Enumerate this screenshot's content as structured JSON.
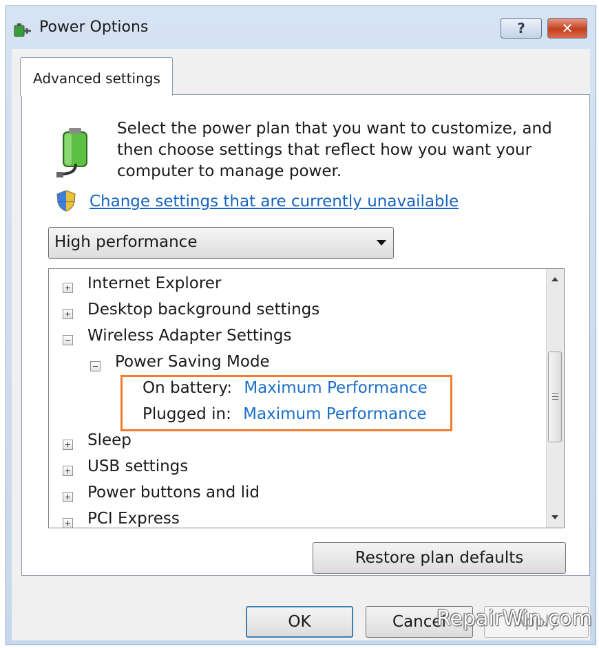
{
  "window": {
    "title": "Power Options",
    "help_label": "?",
    "close_label": "✕"
  },
  "tabs": [
    {
      "label": "Advanced settings"
    }
  ],
  "panel": {
    "description": "Select the power plan that you want to customize, and then choose settings that reflect how you want your computer to manage power.",
    "change_link": "Change settings that are currently unavailable",
    "plan_selected": "High performance"
  },
  "tree": {
    "items": [
      {
        "label": "Internet Explorer",
        "expander": "plus"
      },
      {
        "label": "Desktop background settings",
        "expander": "plus"
      },
      {
        "label": "Wireless Adapter Settings",
        "expander": "minus"
      },
      {
        "label": "Power Saving Mode",
        "expander": "minus"
      },
      {
        "label": "On battery:",
        "value": "Maximum Performance"
      },
      {
        "label": "Plugged in:",
        "value": "Maximum Performance"
      },
      {
        "label": "Sleep",
        "expander": "plus"
      },
      {
        "label": "USB settings",
        "expander": "plus"
      },
      {
        "label": "Power buttons and lid",
        "expander": "plus"
      },
      {
        "label": "PCI Express",
        "expander": "plus"
      }
    ]
  },
  "buttons": {
    "restore": "Restore plan defaults",
    "ok": "OK",
    "cancel": "Cancel",
    "apply": "Apply"
  },
  "watermark": "RepairWin.com",
  "colors": {
    "link": "#1565c0",
    "setting_value": "#1c6fc8",
    "highlight_border": "#f47a2c",
    "close_button": "#c4401f"
  }
}
